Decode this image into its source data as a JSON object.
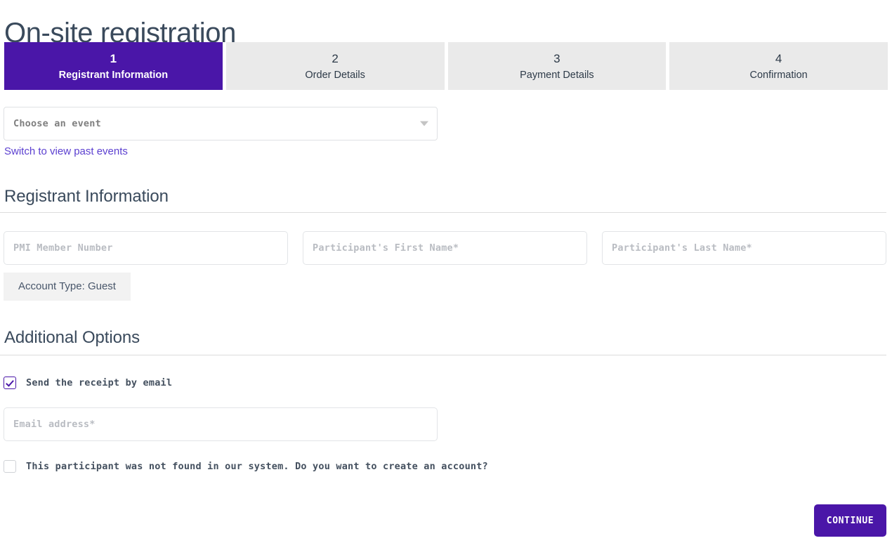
{
  "page": {
    "title": "On-site registration"
  },
  "colors": {
    "accent_purple": "#4a16a8",
    "link_purple": "#5b3fd0",
    "heading_slate": "#3a4a5c",
    "tab_inactive_bg": "#eaeaea",
    "pill_bg": "#f2f2f2"
  },
  "stepper": {
    "steps": [
      {
        "number": "1",
        "label": "Registrant Information",
        "active": true
      },
      {
        "number": "2",
        "label": "Order Details",
        "active": false
      },
      {
        "number": "3",
        "label": "Payment Details",
        "active": false
      },
      {
        "number": "4",
        "label": "Confirmation",
        "active": false
      }
    ]
  },
  "event_select": {
    "value": "Choose an event",
    "caret_icon": "chevron-down-icon"
  },
  "past_events_link": {
    "label": "Switch to view past events"
  },
  "registrant_section": {
    "heading": "Registrant Information",
    "fields": {
      "member_number_placeholder": "PMI Member Number",
      "first_name_placeholder": "Participant's First Name*",
      "last_name_placeholder": "Participant's Last Name*"
    },
    "account_type": "Account Type: Guest"
  },
  "additional_section": {
    "heading": "Additional Options",
    "receipt_checkbox": {
      "label": "Send the receipt by email",
      "checked": true
    },
    "email_placeholder": "Email address*",
    "create_account_checkbox": {
      "label": "This participant was not found in our system. Do you want to create an account?",
      "checked": false
    }
  },
  "footer": {
    "continue_label": "CONTINUE"
  }
}
